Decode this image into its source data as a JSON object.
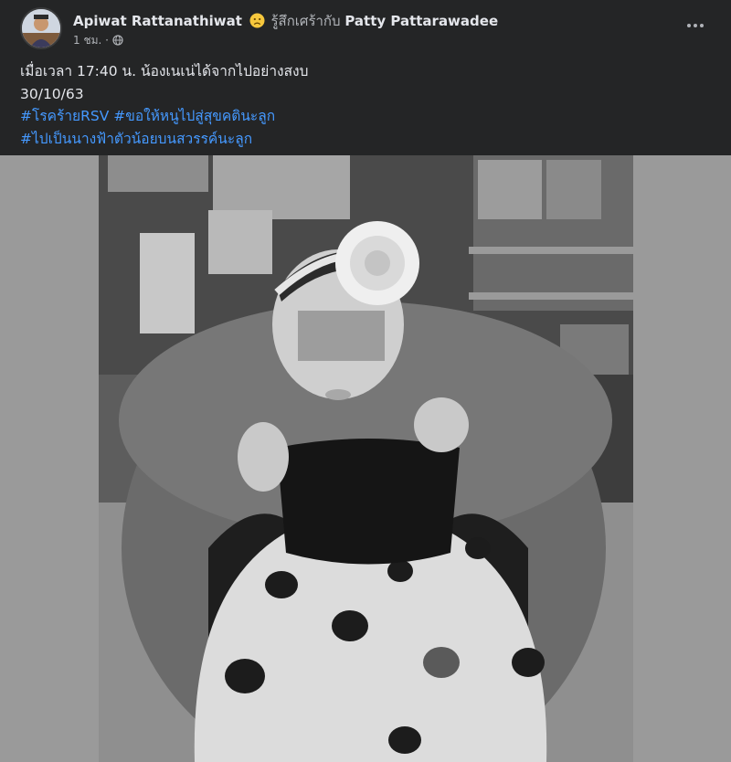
{
  "post": {
    "author": "Apiwat Rattanathiwat",
    "feeling_icon": "sad-face-icon",
    "feeling_text": "รู้สึกเศร้ากับ",
    "tagged_user": "Patty Pattarawadee",
    "timestamp": "1 ชม.",
    "separator": "·",
    "privacy_icon": "globe-icon",
    "more_icon": "more-dots-icon",
    "lines": [
      "เมื่อเวลา 17:40 น. น้องเนเน่ได้จากไปอย่างสงบ",
      "30/10/63"
    ],
    "hashtags": [
      "#โรคร้ายRSV #ขอให้หนูไปสู่สุขคตินะลูก",
      "#ไปเป็นนางฟ้าตัวน้อยบนสวรรค์นะลูก"
    ]
  },
  "colors": {
    "background": "#242526",
    "text": "#e4e6eb",
    "secondary_text": "#b0b3b8",
    "link": "#4599ff"
  }
}
